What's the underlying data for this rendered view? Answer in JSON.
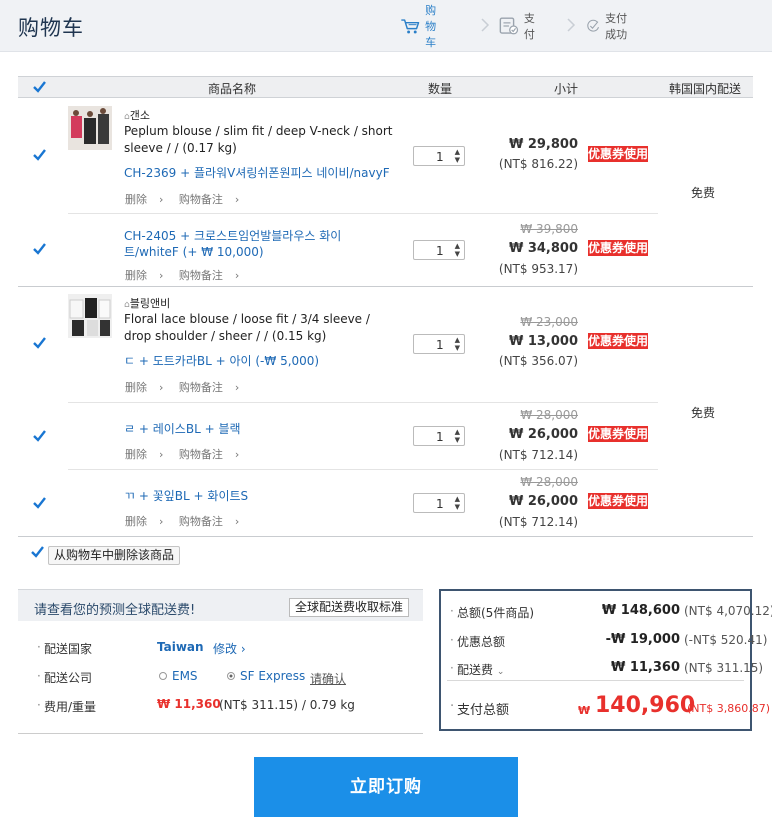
{
  "page": {
    "title": "购物车"
  },
  "steps": [
    {
      "label": "购物车",
      "icon": "shopping-cart-icon"
    },
    {
      "label": "支付",
      "icon": "payment-form-icon"
    },
    {
      "label": "支付成功",
      "icon": "success-check-icon"
    }
  ],
  "table": {
    "headers": {
      "name": "商品名称",
      "qty": "数量",
      "subtotal": "小计",
      "shipping": "韩国国内配送"
    }
  },
  "shops": [
    {
      "seller": "갠소",
      "shipping": "免费"
    },
    {
      "seller": "블링앤비",
      "shipping": "免费"
    }
  ],
  "items": [
    {
      "name": "Peplum blouse / slim fit / deep V-neck / short sleeve / /  (0.17 kg)",
      "option": "CH-2369 + 플라워V셔링쉬폰원피스 네이비/navyF",
      "qty": "1",
      "price_old": "",
      "price": "₩ 29,800",
      "price_nt": "(NT$ 816.22)",
      "coupon": "优惠券使用",
      "delete": "删除",
      "note": "购物备注"
    },
    {
      "name": "",
      "option": "CH-2405 + 크로스트임언발블라우스 화이트/whiteF (+ ₩ 10,000)",
      "qty": "1",
      "price_old": "₩ 39,800",
      "price": "₩ 34,800",
      "price_nt": "(NT$ 953.17)",
      "coupon": "优惠券使用",
      "delete": "删除",
      "note": "购物备注"
    },
    {
      "name": "Floral lace blouse / loose fit / 3/4 sleeve / drop shoulder / sheer /  /  (0.15 kg)",
      "option": "ㄷ + 도트카라BL + 아이 (-₩ 5,000)",
      "qty": "1",
      "price_old": "₩ 23,000",
      "price": "₩ 13,000",
      "price_nt": "(NT$ 356.07)",
      "coupon": "优惠券使用",
      "delete": "删除",
      "note": "购物备注"
    },
    {
      "name": "",
      "option": "ㄹ + 레이스BL + 블랙",
      "qty": "1",
      "price_old": "₩ 28,000",
      "price": "₩ 26,000",
      "price_nt": "(NT$ 712.14)",
      "coupon": "优惠券使用",
      "delete": "删除",
      "note": "购物备注"
    },
    {
      "name": "",
      "option": "ㄲ + 꽃잎BL + 화이트S",
      "qty": "1",
      "price_old": "₩ 28,000",
      "price": "₩ 26,000",
      "price_nt": "(NT$ 712.14)",
      "coupon": "优惠券使用",
      "delete": "删除",
      "note": "购物备注"
    }
  ],
  "delete_selected": "从购物车中删除该商品",
  "shipping_estimate": {
    "title": "请查看您的预测全球配送费!",
    "standard_button": "全球配送费收取标准",
    "country_label": "配送国家",
    "country_value": "Taiwan",
    "change_link": "修改",
    "company_label": "配送公司",
    "option_ems": "EMS",
    "option_sf": "SF Express",
    "confirm_link": "请确认",
    "fee_label": "费用/重量",
    "fee_value": "₩ 11,360",
    "fee_nt": "(NT$ 311.15) /  0.79 kg"
  },
  "summary": {
    "total_label": "总额(5件商品)",
    "total_value": "₩ 148,600",
    "total_nt": "(NT$ 4,070.12)",
    "discount_label": "优惠总额",
    "discount_value": "-₩ 19,000",
    "discount_nt": "(-NT$ 520.41)",
    "shipping_label": "配送费",
    "shipping_value": "₩ 11,360",
    "shipping_nt": "(NT$ 311.15)",
    "pay_label": "支付总额",
    "pay_currency": "₩",
    "pay_value": "140,960",
    "pay_nt": "(NT$ 3,860.87)"
  },
  "order_button": "立即订购",
  "colors": {
    "accent": "#1b8fe8",
    "coupon": "#e8302c",
    "link": "#1e69b5",
    "price_red": "#e8302c"
  }
}
